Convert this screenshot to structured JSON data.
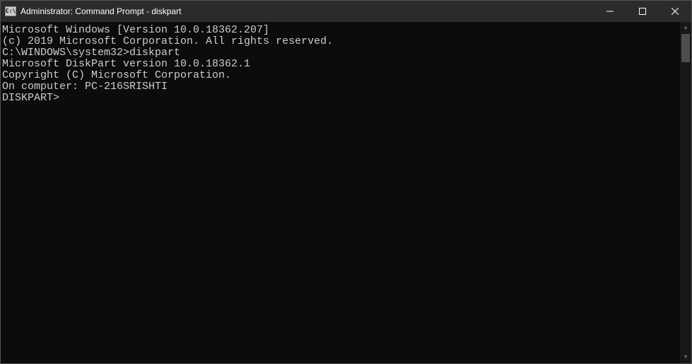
{
  "window": {
    "title": "Administrator: Command Prompt - diskpart",
    "icon_text": "C:\\"
  },
  "terminal": {
    "line1": "Microsoft Windows [Version 10.0.18362.207]",
    "line2": "(c) 2019 Microsoft Corporation. All rights reserved.",
    "blank1": "",
    "prompt1": "C:\\WINDOWS\\system32>diskpart",
    "blank2": "",
    "line3": "Microsoft DiskPart version 10.0.18362.1",
    "blank3": "",
    "line4": "Copyright (C) Microsoft Corporation.",
    "line5": "On computer: PC-216SRISHTI",
    "blank4": "",
    "prompt2": "DISKPART>"
  }
}
